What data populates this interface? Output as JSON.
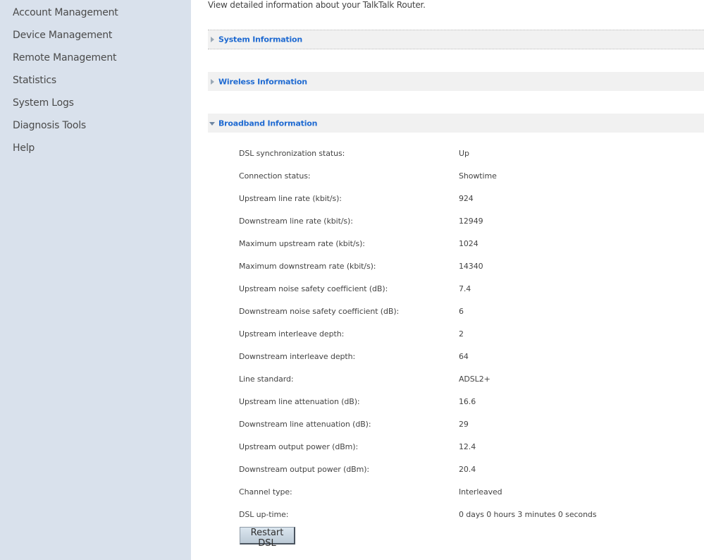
{
  "sidebar": {
    "items": [
      {
        "label": "Account Management"
      },
      {
        "label": "Device Management"
      },
      {
        "label": "Remote Management"
      },
      {
        "label": "Statistics"
      },
      {
        "label": "System Logs"
      },
      {
        "label": "Diagnosis Tools"
      },
      {
        "label": "Help"
      }
    ]
  },
  "main": {
    "intro": "View detailed information about your TalkTalk Router.",
    "sections": [
      {
        "title": "System Information",
        "expanded": false
      },
      {
        "title": "Wireless Information",
        "expanded": false
      },
      {
        "title": "Broadband Information",
        "expanded": true
      }
    ],
    "broadband": {
      "rows": [
        {
          "label": "DSL synchronization status:",
          "value": "Up"
        },
        {
          "label": "Connection status:",
          "value": "Showtime"
        },
        {
          "label": "Upstream line rate (kbit/s):",
          "value": "924"
        },
        {
          "label": "Downstream line rate (kbit/s):",
          "value": "12949"
        },
        {
          "label": "Maximum upstream rate (kbit/s):",
          "value": "1024"
        },
        {
          "label": "Maximum downstream rate (kbit/s):",
          "value": "14340"
        },
        {
          "label": "Upstream noise safety coefficient (dB):",
          "value": "7.4"
        },
        {
          "label": "Downstream noise safety coefficient (dB):",
          "value": "6"
        },
        {
          "label": "Upstream interleave depth:",
          "value": "2"
        },
        {
          "label": "Downstream interleave depth:",
          "value": "64"
        },
        {
          "label": "Line standard:",
          "value": "ADSL2+"
        },
        {
          "label": "Upstream line attenuation (dB):",
          "value": "16.6"
        },
        {
          "label": "Downstream line attenuation (dB):",
          "value": "29"
        },
        {
          "label": "Upstream output power (dBm):",
          "value": "12.4"
        },
        {
          "label": "Downstream output power (dBm):",
          "value": "20.4"
        },
        {
          "label": "Channel type:",
          "value": "Interleaved"
        },
        {
          "label": "DSL up-time:",
          "value": "0 days 0 hours 3 minutes 0 seconds"
        }
      ],
      "restart_label": "Restart DSL"
    }
  },
  "colors": {
    "sidebar_bg": "#d9e1ec",
    "section_title": "#1f6ad1",
    "section_bg": "#f1f1f1"
  }
}
